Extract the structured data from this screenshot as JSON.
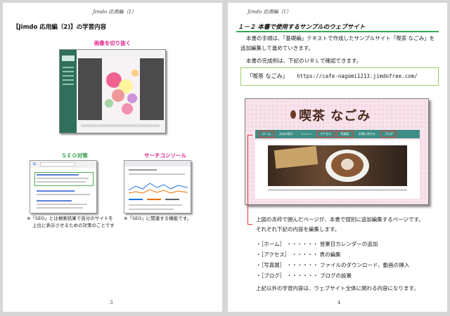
{
  "left_page": {
    "running_head": "Jimdo 応用編（1）",
    "title": "【Jimdo 応用編（2)】の学習内容",
    "image_crop_caption": "画像を切り抜く",
    "seo": {
      "caption": "ＳＥＯ対策",
      "note_line1": "※「SEO」とは検索結果で自分のサイトを",
      "note_line2": "上位に表示させるための対策のことです"
    },
    "search_console": {
      "caption": "サーチコンソール",
      "note": "※「SEO」に関連する機能です。"
    },
    "page_number": "3"
  },
  "right_page": {
    "running_head": "Jimdo 応用編（1）",
    "section_title": "１－２ 本書で使用するサンプルのウェブサイト",
    "intro_line1": "本書の手順は、「基礎編」テキストで作成したサンプルサイト「喫茶 なごみ」を",
    "intro_line2": "追加編集して進めていきます。",
    "check_text": "本書の完成例は、下記のＵＲＬで確認できます。",
    "site_name": "「喫茶 なごみ」",
    "site_url": "https://cafe-nagomi1213.jimdofree.com/",
    "screenshot": {
      "logo": "喫茶 なごみ",
      "nav": [
        "ホーム",
        "お店の紹介",
        "メニュー",
        "アクセス",
        "写真展",
        "お問い合わせ",
        "ブログ"
      ]
    },
    "explain_line1": "上図の赤枠で囲んだページが、本書で個別に追加編集するページです。",
    "explain_line2": "それぞれ下記の内容を編集します。",
    "bullets": [
      "・［ホーム］ ・・・・・・ 営業日カレンダーの追加",
      "・［アクセス］ ・・・・・ 表の編集",
      "・［写真展］ ・・・・・・ ファイルのダウンロード、動画の挿入",
      "・［ブログ］ ・・・・・・ ブログの設置"
    ],
    "closing": "上記以外の学習内容は、ウェブサイト全体に関わる内容になります。",
    "page_number": "4"
  }
}
